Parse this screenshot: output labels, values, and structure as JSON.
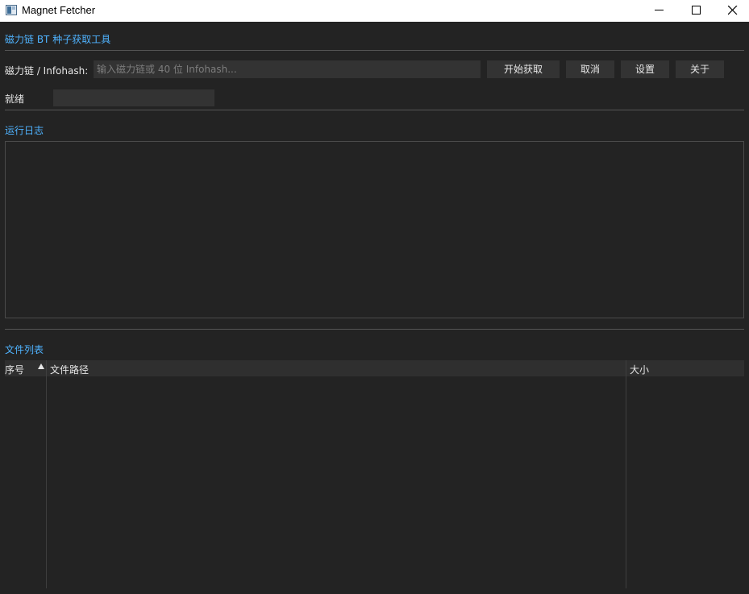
{
  "window": {
    "title": "Magnet Fetcher"
  },
  "header": {
    "title": "磁力链 BT 种子获取工具"
  },
  "input_row": {
    "label": "磁力链 / Infohash:",
    "placeholder": "输入磁力链或 40 位 Infohash...",
    "value": "",
    "buttons": {
      "start": "开始获取",
      "cancel": "取消",
      "settings": "设置",
      "about": "关于"
    }
  },
  "status": {
    "text": "就绪",
    "progress": 0
  },
  "log": {
    "title": "运行日志",
    "content": ""
  },
  "files": {
    "title": "文件列表",
    "columns": [
      "序号",
      "文件路径",
      "大小"
    ],
    "sort_column": "序号",
    "sort_order": "ascending",
    "rows": []
  },
  "icons": {
    "app": "window-app-icon",
    "minimize": "minimize-icon",
    "maximize": "maximize-icon",
    "close": "close-icon",
    "sort": "sort-ascending-icon"
  },
  "colors": {
    "background": "#232323",
    "accent": "#4fb3ff",
    "control": "#333333"
  }
}
